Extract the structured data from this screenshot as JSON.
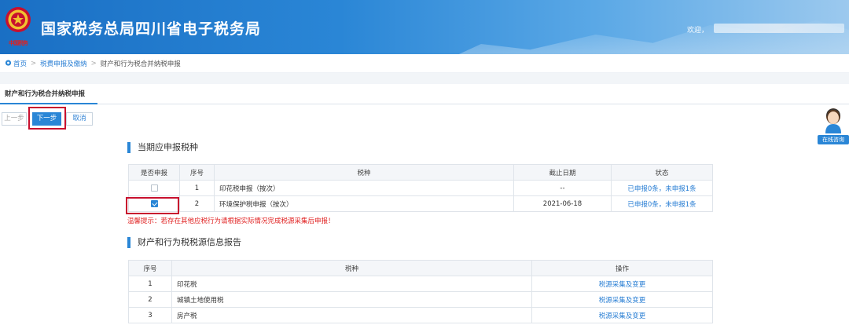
{
  "header": {
    "site_title": "国家税务总局四川省电子税务局",
    "emblem_text": "中国税务",
    "welcome": "欢迎，"
  },
  "breadcrumb": {
    "home": "首页",
    "level2": "税费申报及缴纳",
    "current": "财产和行为税合并纳税申报"
  },
  "tab": {
    "active": "财产和行为税合并纳税申报"
  },
  "buttons": {
    "prev": "上一步",
    "next": "下一步",
    "cancel": "取消"
  },
  "chat": {
    "label": "在线咨询"
  },
  "section1": {
    "title": "当期应申报税种",
    "headers": [
      "是否申报",
      "序号",
      "税种",
      "截止日期",
      "状态"
    ],
    "rows": [
      {
        "checked": false,
        "no": "1",
        "tax": "印花税申报（按次）",
        "deadline": "--",
        "status": "已申报0条，未申报1条"
      },
      {
        "checked": true,
        "no": "2",
        "tax": "环境保护税申报（按次）",
        "deadline": "2021-06-18",
        "status": "已申报0条，未申报1条"
      }
    ],
    "tip": "温馨提示：若存在其他应税行为请根据实际情况完成税源采集后申报！"
  },
  "section2": {
    "title": "财产和行为税税源信息报告",
    "headers": [
      "序号",
      "税种",
      "操作"
    ],
    "rows": [
      {
        "no": "1",
        "tax": "印花税",
        "action": "税源采集及变更"
      },
      {
        "no": "2",
        "tax": "城镇土地使用税",
        "action": "税源采集及变更"
      },
      {
        "no": "3",
        "tax": "房产税",
        "action": "税源采集及变更"
      }
    ]
  },
  "colors": {
    "accent": "#2a86d6",
    "highlight": "#c8102e",
    "tip": "#e02020",
    "link": "#2a7fd4"
  }
}
